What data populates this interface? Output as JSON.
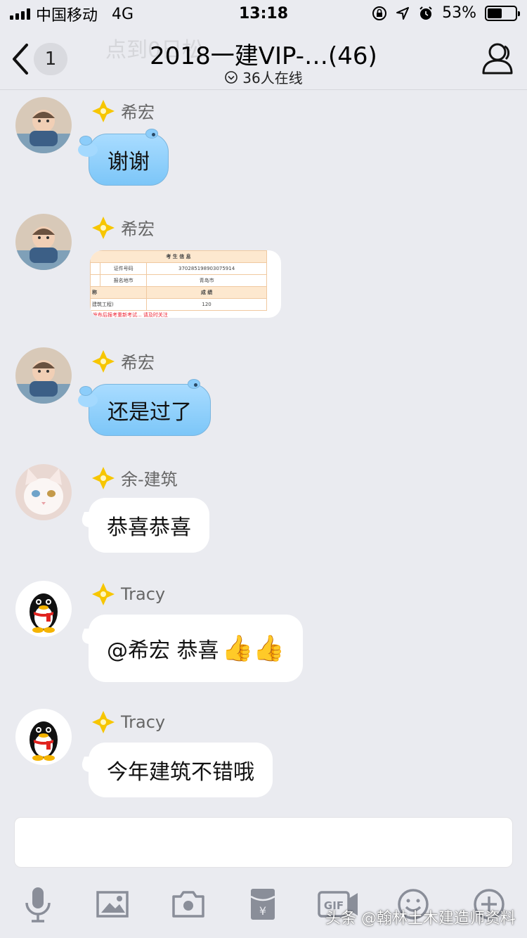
{
  "status_bar": {
    "carrier": "中国移动",
    "network": "4G",
    "time": "13:18",
    "battery_text": "53%",
    "battery_level": 0.53
  },
  "nav": {
    "ghost_text": "点到0日松",
    "back_badge": "1",
    "title": "2018一建VIP-…(46)",
    "online_text": "36人在线"
  },
  "messages": [
    {
      "sender": "希宏",
      "text": "谢谢"
    },
    {
      "sender": "希宏",
      "image": {
        "header": "考 生 信 息",
        "row1_label": "证件号码",
        "row1_value": "370285198903075914",
        "row2_label": "报名地市",
        "row2_value": "青岛市",
        "col_left": "称",
        "col_right": "成  绩",
        "row3_left": "建筑工程)",
        "row3_right": "120",
        "note": "发布后报考重新考试... 请及时关注"
      }
    },
    {
      "sender": "希宏",
      "text": "还是过了"
    },
    {
      "sender": "余-建筑",
      "text": "恭喜恭喜"
    },
    {
      "sender": "Tracy",
      "text": "@希宏 恭喜",
      "emoji": "👍👍"
    },
    {
      "sender": "Tracy",
      "text": "今年建筑不错哦"
    }
  ],
  "input": {
    "placeholder": ""
  },
  "toolbar": {
    "icons": [
      "microphone-icon",
      "image-icon",
      "camera-icon",
      "red-packet-icon",
      "gif-icon",
      "emoji-icon",
      "plus-icon"
    ],
    "gif_label": "GIF",
    "packet_label": "¥"
  },
  "watermark": "头条 @翰林土木建造师资料",
  "colors": {
    "background": "#eaebf0",
    "bubble_blue": "#8fd0fb",
    "bubble_white": "#ffffff",
    "star": "#f7c600"
  }
}
